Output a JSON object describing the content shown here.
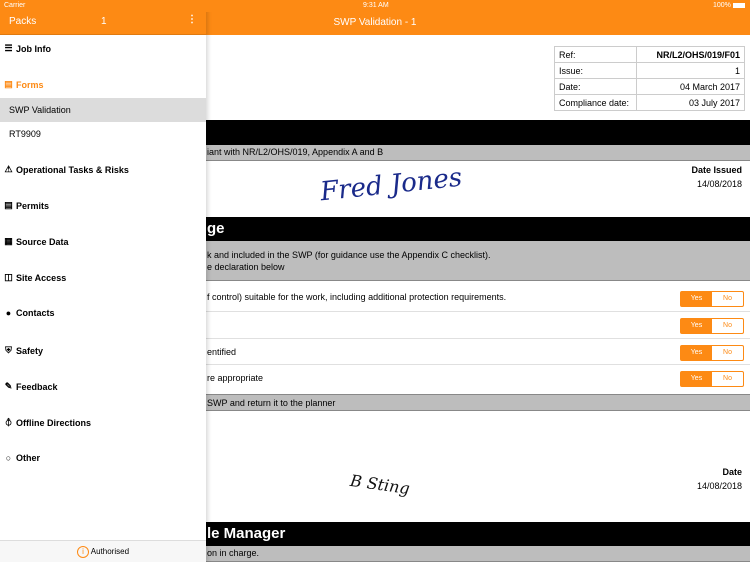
{
  "status": {
    "carrier": "Carrier",
    "time": "9:31 AM",
    "battery": "100%"
  },
  "nav": {
    "title": "SWP Validation - 1"
  },
  "sidebar": {
    "title": "Packs",
    "count": "1",
    "menu_icon": "more-vertical-icon",
    "job_info": "Job Info",
    "forms": "Forms",
    "form_items": [
      "SWP Validation",
      "RT9909"
    ],
    "items": [
      {
        "label": "Operational Tasks & Risks",
        "icon": "warning-icon"
      },
      {
        "label": "Permits",
        "icon": "document-icon"
      },
      {
        "label": "Source Data",
        "icon": "source-icon"
      },
      {
        "label": "Site Access",
        "icon": "map-icon"
      },
      {
        "label": "Contacts",
        "icon": "person-icon"
      },
      {
        "label": "Safety",
        "icon": "shield-icon"
      },
      {
        "label": "Feedback",
        "icon": "edit-icon"
      },
      {
        "label": "Offline Directions",
        "icon": "compass-icon"
      },
      {
        "label": "Other",
        "icon": "circle-icon"
      }
    ],
    "footer": "Authorised",
    "accent": "#fd8a14"
  },
  "ref_table": [
    {
      "k": "Ref:",
      "v": "NR/L2/OHS/019/F01"
    },
    {
      "k": "Issue:",
      "v": "1"
    },
    {
      "k": "Date:",
      "v": "04 March 2017"
    },
    {
      "k": "Compliance date:",
      "v": "03 July 2017"
    }
  ],
  "form": {
    "grey1": "iant with NR/L2/OHS/019, Appendix A and B",
    "sig1_text": "Fred Jones",
    "date_issued_label": "Date Issued",
    "date_issued": "14/08/2018",
    "section2": "ge",
    "grey2_l1": "k and included in the SWP (for guidance use the Appendix C checklist).",
    "grey2_l2": "e declaration below",
    "questions": [
      "f control) suitable for the work, including additional protection requirements.",
      "",
      "entified",
      "re appropriate"
    ],
    "yes": "Yes",
    "no": "No",
    "grey3": "SWP and return it to the planner",
    "sig2_text": "B Sting",
    "date_label": "Date",
    "date": "14/08/2018",
    "section3": "le Manager",
    "grey4": "on in charge."
  }
}
